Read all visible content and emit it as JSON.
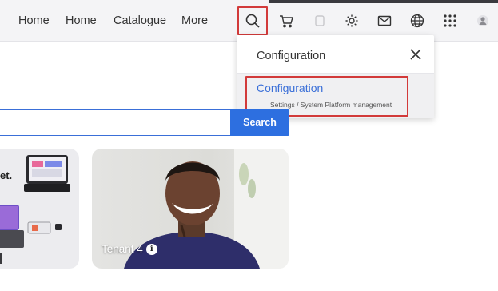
{
  "nav": {
    "links": [
      "Home",
      "Home",
      "Catalogue",
      "More"
    ],
    "icons": [
      "search-icon",
      "cart-icon",
      "gear-icon",
      "mail-icon",
      "globe-icon",
      "grid-icon",
      "avatar"
    ]
  },
  "dropdown": {
    "title": "Configuration",
    "result": {
      "title": "Configuration",
      "path": "Settings / System Platform management"
    }
  },
  "search": {
    "value": "",
    "button_label": "Search"
  },
  "tiles": [
    {
      "caption": "et."
    },
    {
      "caption": "Tenant 4"
    }
  ],
  "colors": {
    "accent": "#2d6fe0",
    "highlight": "#d23a3a",
    "link": "#3a6fd8"
  }
}
